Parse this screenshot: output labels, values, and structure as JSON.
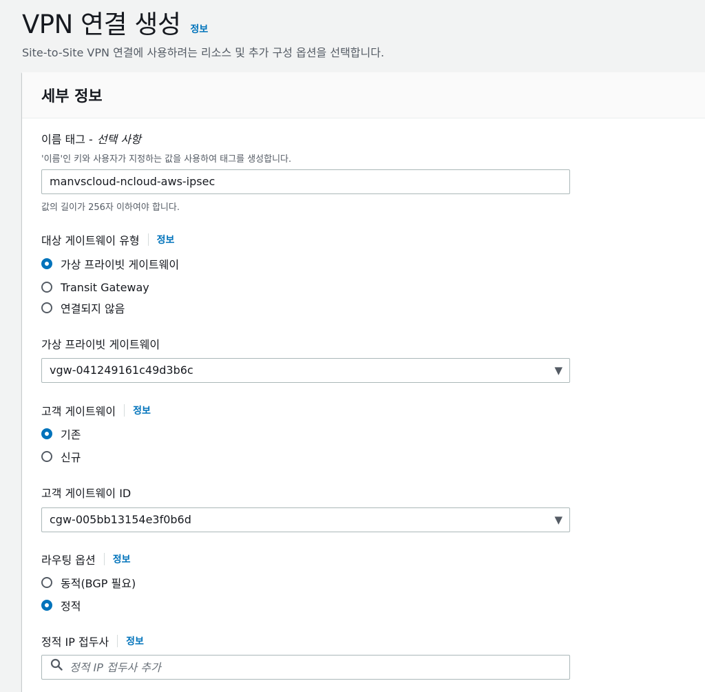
{
  "header": {
    "title": "VPN 연결 생성",
    "info": "정보",
    "description": "Site-to-Site VPN 연결에 사용하려는 리소스 및 추가 구성 옵션을 선택합니다."
  },
  "panel": {
    "title": "세부 정보"
  },
  "name_tag": {
    "label": "이름 태그 -",
    "optional": "선택 사항",
    "description": "'이름'인 키와 사용자가 지정하는 값을 사용하여 태그를 생성합니다.",
    "value": "manvscloud-ncloud-aws-ipsec",
    "constraint": "값의 길이가 256자 이하여야 합니다."
  },
  "target_gateway_type": {
    "label": "대상 게이트웨이 유형",
    "info": "정보",
    "options": [
      "가상 프라이빗 게이트웨이",
      "Transit Gateway",
      "연결되지 않음"
    ]
  },
  "virtual_private_gateway": {
    "label": "가상 프라이빗 게이트웨이",
    "value": "vgw-041249161c49d3b6c"
  },
  "customer_gateway": {
    "label": "고객 게이트웨이",
    "info": "정보",
    "options": [
      "기존",
      "신규"
    ]
  },
  "customer_gateway_id": {
    "label": "고객 게이트웨이 ID",
    "value": "cgw-005bb13154e3f0b6d"
  },
  "routing_options": {
    "label": "라우팅 옵션",
    "info": "정보",
    "options": [
      "동적(BGP 필요)",
      "정적"
    ]
  },
  "static_ip_prefix": {
    "label": "정적 IP 접두사",
    "info": "정보",
    "placeholder": "정적 IP 접두사 추가"
  },
  "colors": {
    "accent": "#0073bb",
    "background": "#f2f3f3",
    "panel_header": "#fafafa",
    "border": "#aab7b8"
  }
}
